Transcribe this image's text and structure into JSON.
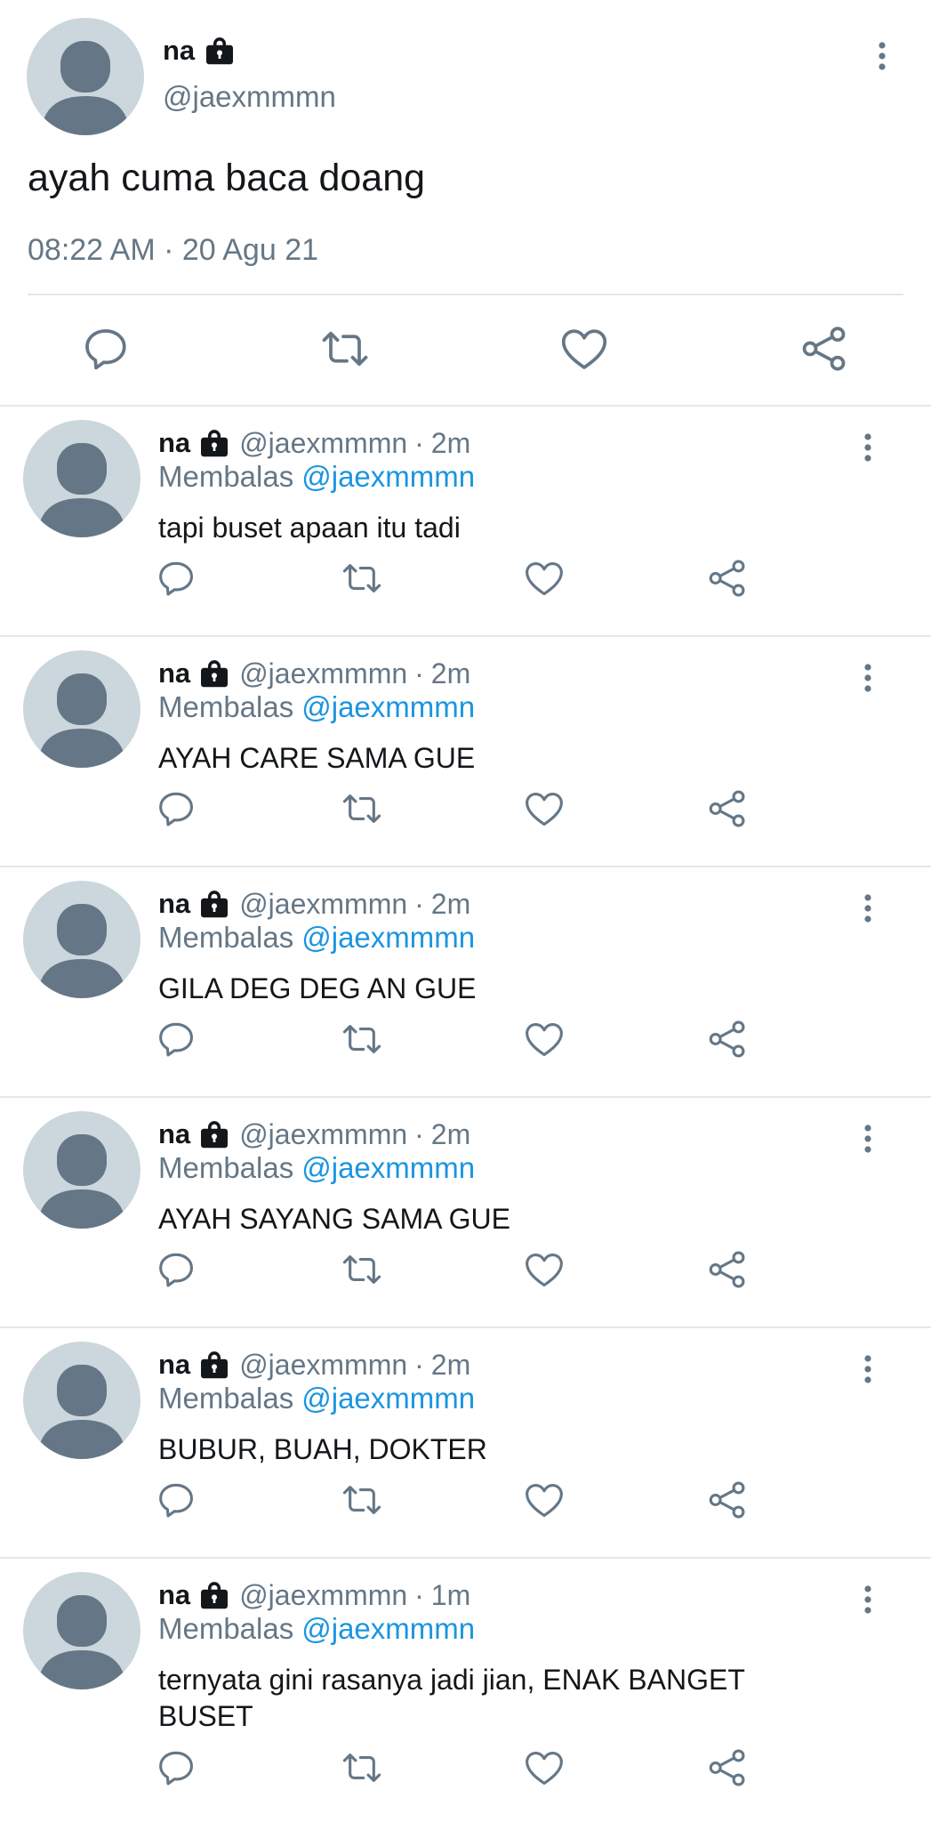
{
  "colors": {
    "text": "#14171a",
    "secondary": "#657786",
    "mention": "#1b95e0",
    "icon": "#657786",
    "divider": "#e1e8ed",
    "avatar_bg": "#ccd6dd",
    "avatar_fg": "#657786"
  },
  "icons": {
    "protected": "lock-icon",
    "menu": "more-vertical-icon",
    "reply": "reply-icon",
    "retweet": "retweet-icon",
    "like": "heart-icon",
    "share": "share-icon"
  },
  "main_tweet": {
    "name": "na",
    "handle": "@jaexmmmn",
    "text": "ayah cuma baca doang",
    "timestamp": "08:22 AM · 20 Agu 21"
  },
  "replying_label": "Membalas",
  "time_separator": "·",
  "replies": [
    {
      "name": "na",
      "handle": "@jaexmmmn",
      "time": "2m",
      "reply_to": "@jaexmmmn",
      "text": "tapi buset apaan itu tadi"
    },
    {
      "name": "na",
      "handle": "@jaexmmmn",
      "time": "2m",
      "reply_to": "@jaexmmmn",
      "text": "AYAH CARE SAMA GUE"
    },
    {
      "name": "na",
      "handle": "@jaexmmmn",
      "time": "2m",
      "reply_to": "@jaexmmmn",
      "text": "GILA DEG DEG AN GUE"
    },
    {
      "name": "na",
      "handle": "@jaexmmmn",
      "time": "2m",
      "reply_to": "@jaexmmmn",
      "text": "AYAH SAYANG SAMA GUE"
    },
    {
      "name": "na",
      "handle": "@jaexmmmn",
      "time": "2m",
      "reply_to": "@jaexmmmn",
      "text": "BUBUR, BUAH, DOKTER"
    },
    {
      "name": "na",
      "handle": "@jaexmmmn",
      "time": "1m",
      "reply_to": "@jaexmmmn",
      "text": "ternyata gini rasanya jadi jian, ENAK BANGET BUSET"
    }
  ]
}
